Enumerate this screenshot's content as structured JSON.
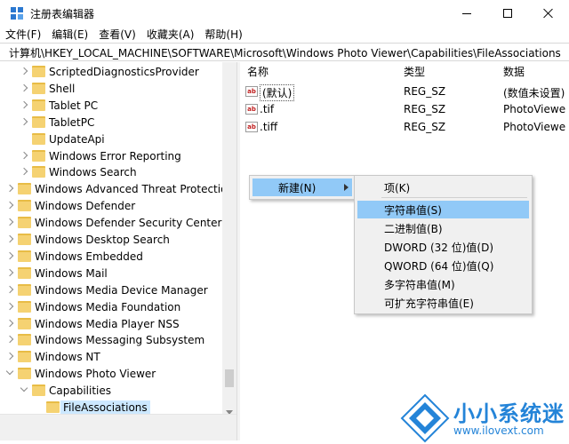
{
  "window": {
    "title": "注册表编辑器"
  },
  "menubar": [
    "文件(F)",
    "编辑(E)",
    "查看(V)",
    "收藏夹(A)",
    "帮助(H)"
  ],
  "address": "计算机\\HKEY_LOCAL_MACHINE\\SOFTWARE\\Microsoft\\Windows Photo Viewer\\Capabilities\\FileAssociations",
  "tree": [
    {
      "label": "ScriptedDiagnosticsProvider",
      "level": 1,
      "state": "collapsed"
    },
    {
      "label": "Shell",
      "level": 1,
      "state": "collapsed"
    },
    {
      "label": "Tablet PC",
      "level": 1,
      "state": "collapsed"
    },
    {
      "label": "TabletPC",
      "level": 1,
      "state": "collapsed"
    },
    {
      "label": "UpdateApi",
      "level": 1,
      "state": "none"
    },
    {
      "label": "Windows Error Reporting",
      "level": 1,
      "state": "collapsed"
    },
    {
      "label": "Windows Search",
      "level": 1,
      "state": "collapsed"
    },
    {
      "label": "Windows Advanced Threat Protection",
      "level": 0,
      "state": "collapsed"
    },
    {
      "label": "Windows Defender",
      "level": 0,
      "state": "collapsed"
    },
    {
      "label": "Windows Defender Security Center",
      "level": 0,
      "state": "collapsed"
    },
    {
      "label": "Windows Desktop Search",
      "level": 0,
      "state": "collapsed"
    },
    {
      "label": "Windows Embedded",
      "level": 0,
      "state": "collapsed"
    },
    {
      "label": "Windows Mail",
      "level": 0,
      "state": "collapsed"
    },
    {
      "label": "Windows Media Device Manager",
      "level": 0,
      "state": "collapsed"
    },
    {
      "label": "Windows Media Foundation",
      "level": 0,
      "state": "collapsed"
    },
    {
      "label": "Windows Media Player NSS",
      "level": 0,
      "state": "collapsed"
    },
    {
      "label": "Windows Messaging Subsystem",
      "level": 0,
      "state": "collapsed"
    },
    {
      "label": "Windows NT",
      "level": 0,
      "state": "collapsed"
    },
    {
      "label": "Windows Photo Viewer",
      "level": 0,
      "state": "expanded"
    },
    {
      "label": "Capabilities",
      "level": 1,
      "state": "expanded"
    },
    {
      "label": "FileAssociations",
      "level": 2,
      "state": "none",
      "selected": true
    }
  ],
  "values": {
    "columns": {
      "name": "名称",
      "type": "类型",
      "data": "数据"
    },
    "rows": [
      {
        "name": "(默认)",
        "type": "REG_SZ",
        "data": "(数值未设置)"
      },
      {
        "name": ".tif",
        "type": "REG_SZ",
        "data": "PhotoViewe"
      },
      {
        "name": ".tiff",
        "type": "REG_SZ",
        "data": "PhotoViewe"
      }
    ]
  },
  "context_menu": {
    "new_label": "新建(N)",
    "submenu": [
      "项(K)",
      "字符串值(S)",
      "二进制值(B)",
      "DWORD (32 位)值(D)",
      "QWORD (64 位)值(Q)",
      "多字符串值(M)",
      "可扩充字符串值(E)"
    ],
    "highlighted": "字符串值(S)"
  },
  "watermark": {
    "name": "小小系统迷",
    "url": "www.ilovext.com"
  },
  "colors": {
    "selection": "#cce8ff",
    "menu_highlight": "#91c9f7",
    "folder": "#f5d272",
    "watermark_blue": "#2484d8"
  },
  "icons": [
    "regedit-icon",
    "folder-icon",
    "chevron-right-icon",
    "chevron-down-icon",
    "string-value-icon",
    "submenu-arrow-icon",
    "minimize-icon",
    "maximize-icon",
    "close-icon"
  ]
}
